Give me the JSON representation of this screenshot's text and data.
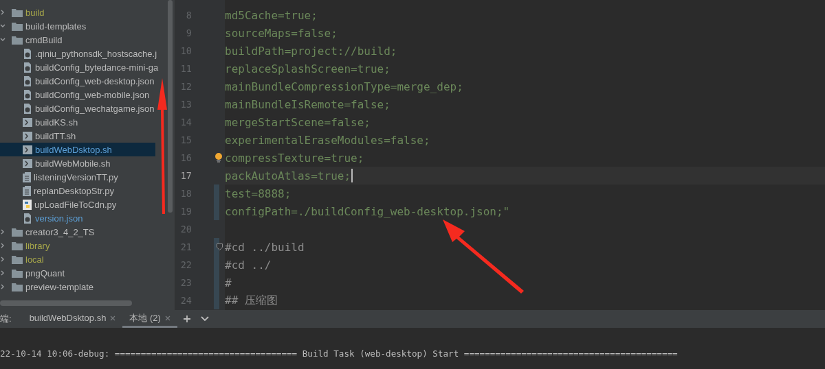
{
  "project_tree": [
    {
      "name": "build",
      "kind": "folder",
      "expanded": false,
      "color": "#a7a74a",
      "selected": false
    },
    {
      "name": "build-templates",
      "kind": "folder",
      "expanded": true,
      "color": "#bbbbbb",
      "selected": false
    },
    {
      "name": "cmdBuild",
      "kind": "folder",
      "expanded": true,
      "color": "#bbbbbb",
      "selected": false,
      "children": [
        {
          "name": ".qiniu_pythonsdk_hostscache.j",
          "kind": "json",
          "color": "#bbbbbb",
          "selected": false
        },
        {
          "name": "buildConfig_bytedance-mini-ga",
          "kind": "json",
          "color": "#bbbbbb",
          "selected": false
        },
        {
          "name": "buildConfig_web-desktop.json",
          "kind": "json",
          "color": "#bbbbbb",
          "selected": false
        },
        {
          "name": "buildConfig_web-mobile.json",
          "kind": "json",
          "color": "#bbbbbb",
          "selected": false
        },
        {
          "name": "buildConfig_wechatgame.json",
          "kind": "json",
          "color": "#bbbbbb",
          "selected": false
        },
        {
          "name": "buildKS.sh",
          "kind": "shell",
          "color": "#bbbbbb",
          "selected": false
        },
        {
          "name": "buildTT.sh",
          "kind": "shell",
          "color": "#bbbbbb",
          "selected": false
        },
        {
          "name": "buildWebDsktop.sh",
          "kind": "shell",
          "color": "#5c9fd6",
          "selected": true
        },
        {
          "name": "buildWebMobile.sh",
          "kind": "shell",
          "color": "#bbbbbb",
          "selected": false
        },
        {
          "name": "listeningVersionTT.py",
          "kind": "text",
          "color": "#bbbbbb",
          "selected": false
        },
        {
          "name": "replanDesktopStr.py",
          "kind": "text",
          "color": "#bbbbbb",
          "selected": false
        },
        {
          "name": "upLoadFileToCdn.py",
          "kind": "python",
          "color": "#bbbbbb",
          "selected": false
        },
        {
          "name": "version.json",
          "kind": "json",
          "color": "#5c9fd6",
          "selected": false
        }
      ]
    },
    {
      "name": "creator3_4_2_TS",
      "kind": "folder",
      "expanded": false,
      "color": "#bbbbbb",
      "selected": false
    },
    {
      "name": "library",
      "kind": "folder",
      "expanded": false,
      "color": "#a7a74a",
      "selected": false
    },
    {
      "name": "local",
      "kind": "folder",
      "expanded": false,
      "color": "#a7a74a",
      "selected": false
    },
    {
      "name": "pngQuant",
      "kind": "folder",
      "expanded": false,
      "color": "#bbbbbb",
      "selected": false
    },
    {
      "name": "preview-template",
      "kind": "folder",
      "expanded": false,
      "color": "#bbbbbb",
      "selected": false
    }
  ],
  "editor_lines": [
    {
      "number": "8",
      "text": "md5Cache=true;",
      "kind": "string",
      "current": false,
      "changed": false
    },
    {
      "number": "9",
      "text": "sourceMaps=false;",
      "kind": "string",
      "current": false,
      "changed": false
    },
    {
      "number": "10",
      "text": "buildPath=project://build;",
      "kind": "string",
      "current": false,
      "changed": false
    },
    {
      "number": "11",
      "text": "replaceSplashScreen=true;",
      "kind": "string",
      "current": false,
      "changed": false
    },
    {
      "number": "12",
      "text": "mainBundleCompressionType=merge_dep;",
      "kind": "string",
      "current": false,
      "changed": false
    },
    {
      "number": "13",
      "text": "mainBundleIsRemote=false;",
      "kind": "string",
      "current": false,
      "changed": false
    },
    {
      "number": "14",
      "text": "mergeStartScene=false;",
      "kind": "string",
      "current": false,
      "changed": false
    },
    {
      "number": "15",
      "text": "experimentalEraseModules=false;",
      "kind": "string",
      "current": false,
      "changed": false
    },
    {
      "number": "16",
      "text": "compressTexture=true;",
      "kind": "string",
      "current": false,
      "changed": false,
      "bulb": true
    },
    {
      "number": "17",
      "text": "packAutoAtlas=true;",
      "kind": "string",
      "current": true,
      "changed": false
    },
    {
      "number": "18",
      "text": "test=8888;",
      "kind": "string",
      "current": false,
      "changed": true
    },
    {
      "number": "19",
      "text": "configPath=./buildConfig_web-desktop.json;\"",
      "kind": "string",
      "current": false,
      "changed": true
    },
    {
      "number": "20",
      "current": false,
      "changed": false
    },
    {
      "number": "21",
      "text": "#cd ../build",
      "kind": "comment",
      "current": false,
      "changed": true,
      "foldable": true
    },
    {
      "number": "22",
      "text": "#cd ../",
      "kind": "comment",
      "current": false,
      "changed": true
    },
    {
      "number": "23",
      "text": "#",
      "kind": "comment",
      "current": false,
      "changed": true
    },
    {
      "number": "24",
      "text": "## 压缩图",
      "kind": "comment",
      "current": false,
      "changed": true
    }
  ],
  "terminal": {
    "label": "端:",
    "tabs": [
      {
        "label": "buildWebDsktop.sh",
        "selected": false
      },
      {
        "label": "本地 (2)",
        "selected": true
      }
    ],
    "output": "22-10-14 10:06-debug: =================================== Build Task (web-desktop) Start ========================================="
  }
}
